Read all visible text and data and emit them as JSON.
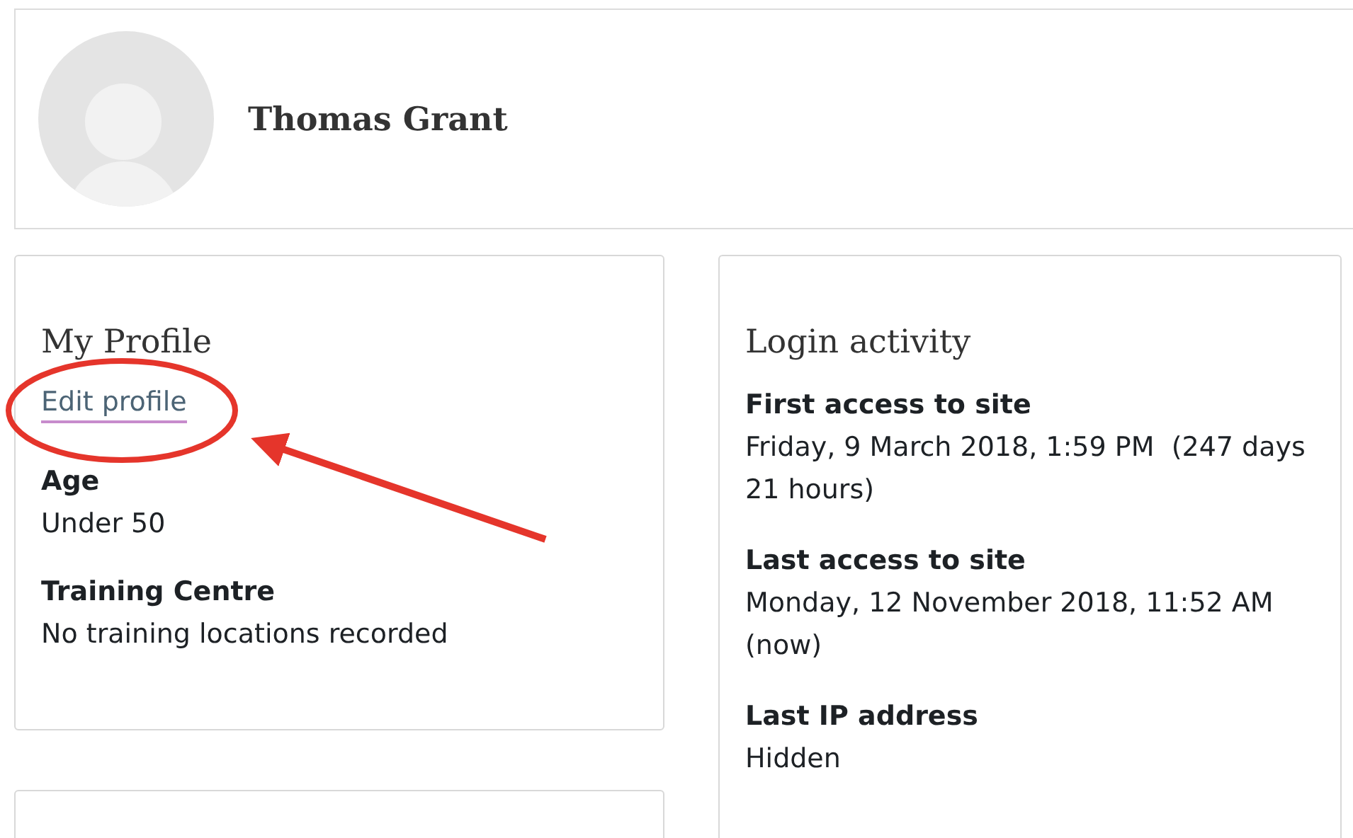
{
  "user": {
    "name": "Thomas Grant"
  },
  "profile": {
    "title": "My Profile",
    "edit_link": "Edit profile",
    "fields": [
      {
        "label": "Age",
        "value": "Under 50"
      },
      {
        "label": "Training Centre",
        "value": "No training locations recorded"
      }
    ]
  },
  "login_activity": {
    "title": "Login activity",
    "fields": [
      {
        "label": "First access to site",
        "value": "Friday, 9 March 2018, 1:59 PM  (247 days 21 hours)"
      },
      {
        "label": "Last access to site",
        "value": "Monday, 12 November 2018, 11:52 AM (now)"
      },
      {
        "label": "Last IP address",
        "value": "Hidden"
      }
    ]
  }
}
